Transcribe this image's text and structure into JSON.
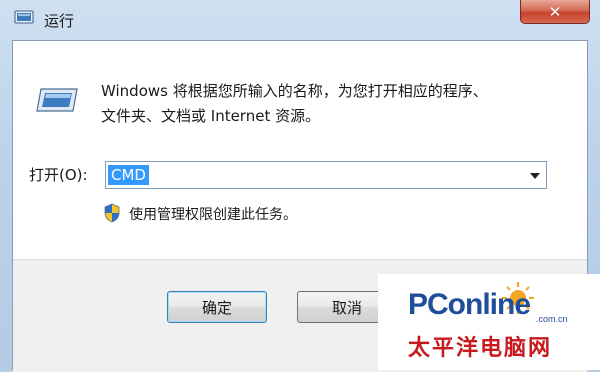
{
  "window": {
    "title": "运行",
    "close_glyph": "✕"
  },
  "dialog": {
    "description_line1": "Windows 将根据您所输入的名称，为您打开相应的程序、",
    "description_line2": "文件夹、文档或 Internet 资源。",
    "open_label": "打开(O):",
    "open_value": "CMD",
    "admin_notice": "使用管理权限创建此任务。",
    "ok_label": "确定",
    "cancel_label": "取消"
  },
  "watermark": {
    "brand": "PConline",
    "domain": ".com.cn",
    "chinese": "太平洋电脑网"
  },
  "icons": {
    "title": "run-icon",
    "app": "run-app-icon",
    "shield": "uac-shield-icon",
    "dropdown": "chevron-down-icon"
  },
  "colors": {
    "selection": "#3399ff",
    "close_button": "#c7422b",
    "watermark_blue": "#1f4e9b",
    "watermark_red": "#c8191e"
  }
}
